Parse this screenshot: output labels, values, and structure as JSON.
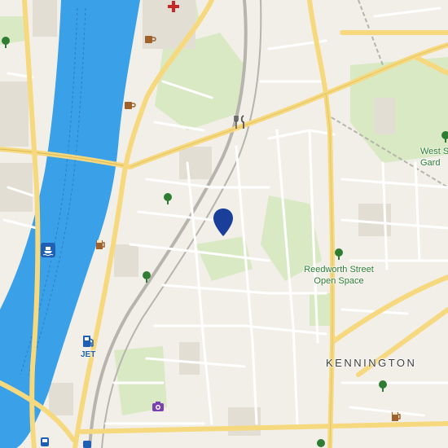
{
  "map": {
    "labels": {
      "park_main_line1": "Reedworth Street",
      "park_main_line2": "Open Space",
      "park_edge_line1": "West S",
      "park_edge_line2": "Gard",
      "district": "KENNINGTON",
      "fuel_brand": "JET"
    },
    "colors": {
      "land": "#f2efe9",
      "water": "#3aa0e8",
      "park": "#d8e9c4",
      "building": "#e3ded4",
      "major_road": "#f6d97e",
      "road": "#ffffff",
      "rail": "#b7b3ad",
      "pin": "#1a3f9a",
      "tree": "#2e7d32",
      "pub": "#a0622d",
      "hospital": "#c62828",
      "camera": "#7b3fb0",
      "fuel": "#1e5fb4"
    },
    "icons": [
      "location-pin-icon",
      "hospital-icon",
      "cafe-icon",
      "restaurant-icon",
      "tree-icon",
      "pub-icon",
      "ferry-icon",
      "fuel-station-icon",
      "camera-icon",
      "bus-icon"
    ]
  }
}
